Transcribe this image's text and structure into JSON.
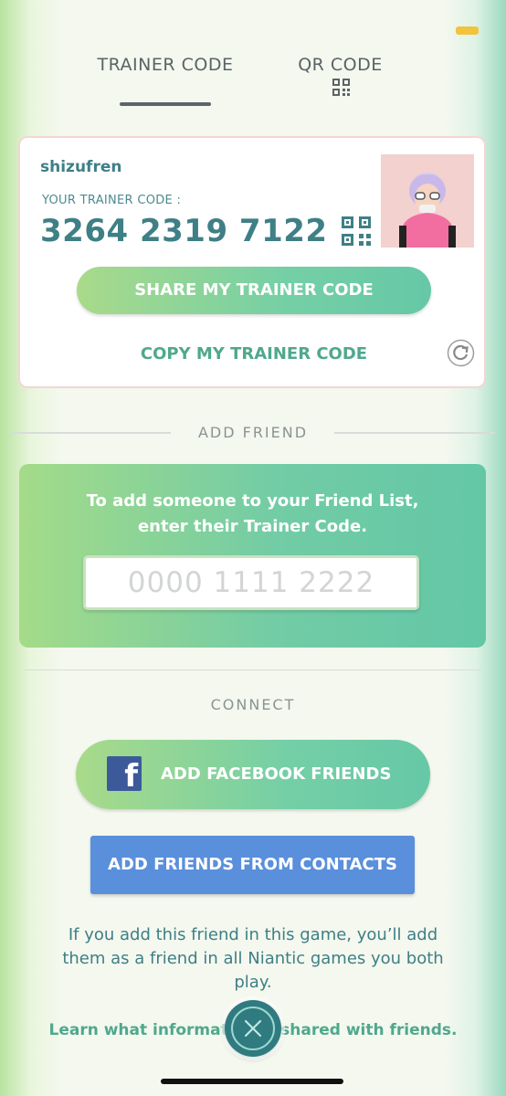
{
  "tabs": [
    {
      "label": "TRAINER CODE",
      "active": true
    },
    {
      "label": "QR CODE",
      "active": false
    }
  ],
  "profile": {
    "username": "shizufren",
    "code_label": "YOUR TRAINER CODE :",
    "trainer_code": "3264 2319 7122",
    "share_label": "SHARE MY TRAINER CODE",
    "copy_label": "COPY MY TRAINER CODE"
  },
  "add_friend": {
    "heading": "ADD FRIEND",
    "instruction": "To add someone to your Friend List, enter their Trainer Code.",
    "input_placeholder": "0000 1111 2222",
    "input_value": ""
  },
  "connect": {
    "heading": "CONNECT",
    "facebook_label": "ADD FACEBOOK FRIENDS",
    "contacts_label": "ADD FRIENDS FROM CONTACTS",
    "info": "If you add this friend in this game, you’ll add them as a friend in all Niantic games you both play.",
    "learn_link": "Learn what information is shared with friends."
  },
  "colors": {
    "accent_green": "#72cca5",
    "teal_text": "#3f7f86",
    "contacts_blue": "#5a8fdc",
    "facebook_blue": "#3c5a99",
    "status_yellow": "#f2c33c"
  },
  "icons": [
    "qr-code-icon",
    "refresh-icon",
    "facebook-icon",
    "close-icon"
  ]
}
